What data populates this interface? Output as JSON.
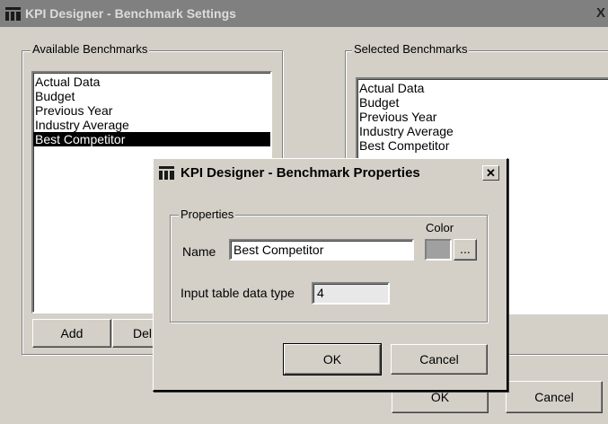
{
  "main_window": {
    "title": "KPI Designer - Benchmark Settings",
    "close_glyph": "X",
    "available_group_label": "Available Benchmarks",
    "selected_group_label": "Selected Benchmarks",
    "available_items": [
      "Actual Data",
      "Budget",
      "Previous Year",
      "Industry Average",
      "Best Competitor"
    ],
    "selected_available_item": "Best Competitor",
    "selected_items": [
      "Actual Data",
      "Budget",
      "Previous Year",
      "Industry Average",
      "Best Competitor"
    ],
    "add_label": "Add",
    "delete_label_partial": "Del",
    "ok_label": "OK",
    "cancel_label": "Cancel"
  },
  "dialog": {
    "title": "KPI Designer - Benchmark Properties",
    "close_glyph": "✕",
    "group_label": "Properties",
    "name_label": "Name",
    "name_value": "Best Competitor",
    "color_label": "Color",
    "color_value": "#a0a0a0",
    "color_picker_label": "...",
    "datatype_label": "Input table data type",
    "datatype_value": "4",
    "ok_label": "OK",
    "cancel_label": "Cancel"
  },
  "icons": {
    "app_icon": "kpi-designer-icon"
  }
}
